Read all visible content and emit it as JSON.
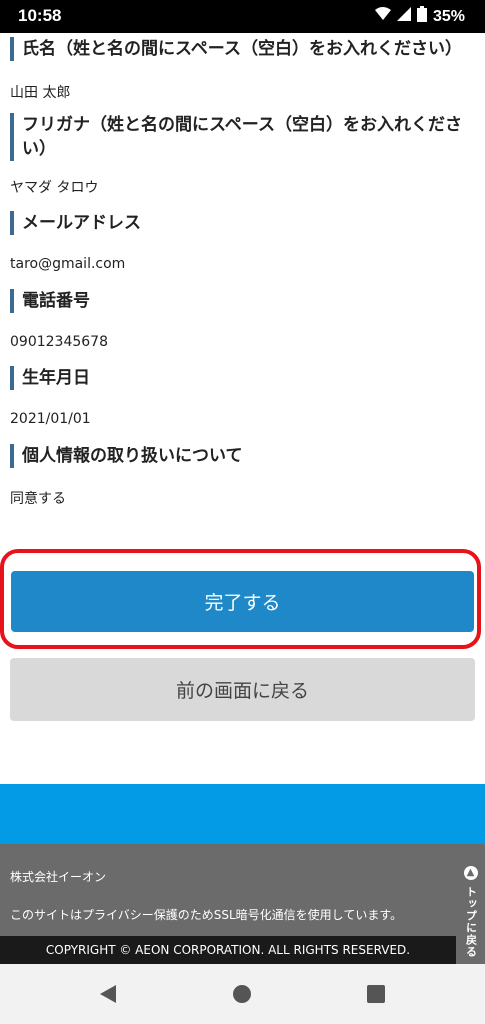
{
  "status_bar": {
    "time": "10:58",
    "battery": "35%"
  },
  "fields": [
    {
      "label": "氏名（姓と名の間にスペース（空白）をお入れください）",
      "value": "山田 太郎"
    },
    {
      "label": "フリガナ（姓と名の間にスペース（空白）をお入れください）",
      "value": "ヤマダ タロウ"
    },
    {
      "label": "メールアドレス",
      "value": "taro@gmail.com"
    },
    {
      "label": "電話番号",
      "value": "09012345678"
    },
    {
      "label": "生年月日",
      "value": "2021/01/01"
    },
    {
      "label": "個人情報の取り扱いについて",
      "value": "同意する"
    }
  ],
  "buttons": {
    "complete": "完了する",
    "back": "前の画面に戻る"
  },
  "footer": {
    "company": "株式会社イーオン",
    "ssl_notice": "このサイトはプライバシー保護のためSSL暗号化通信を使用しています。",
    "copyright": "COPYRIGHT © AEON CORPORATION. ALL RIGHTS RESERVED.",
    "to_top": "トップに戻る"
  },
  "colors": {
    "primary": "#1e88c8",
    "highlight": "#e8121b",
    "band": "#039be5",
    "footer": "#6b6b6b"
  }
}
